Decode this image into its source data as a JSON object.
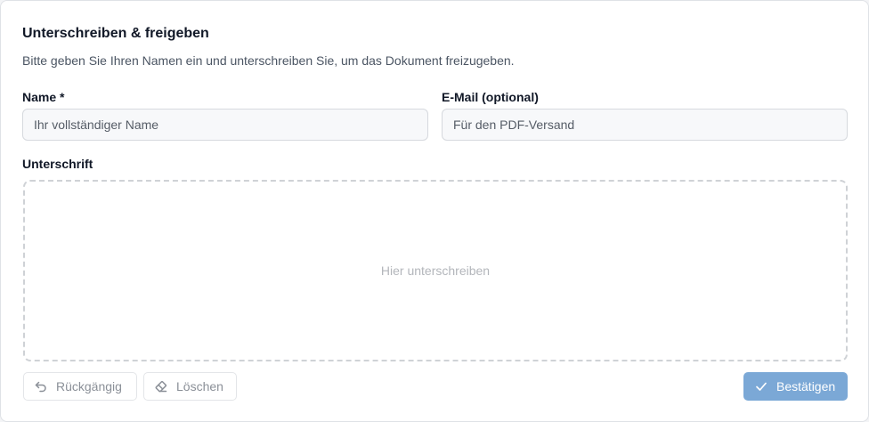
{
  "dialog": {
    "title": "Unterschreiben & freigeben",
    "subtitle": "Bitte geben Sie Ihren Namen ein und unterschreiben Sie, um das Dokument freizugeben."
  },
  "form": {
    "name_label": "Name *",
    "name_placeholder": "Ihr vollständiger Name",
    "name_value": "",
    "email_label": "E-Mail (optional)",
    "email_placeholder": "Für den PDF-Versand",
    "email_value": "",
    "signature_label": "Unterschrift",
    "signature_placeholder": "Hier unterschreiben"
  },
  "actions": {
    "undo_label": "Rückgängig",
    "undo_icon": "undo-icon",
    "clear_label": "Löschen",
    "clear_icon": "eraser-icon",
    "confirm_label": "Bestätigen",
    "confirm_icon": "check-icon"
  },
  "colors": {
    "primary": "#7ba8d6",
    "border": "#d6d9de",
    "placeholder": "#b3b6bb"
  }
}
